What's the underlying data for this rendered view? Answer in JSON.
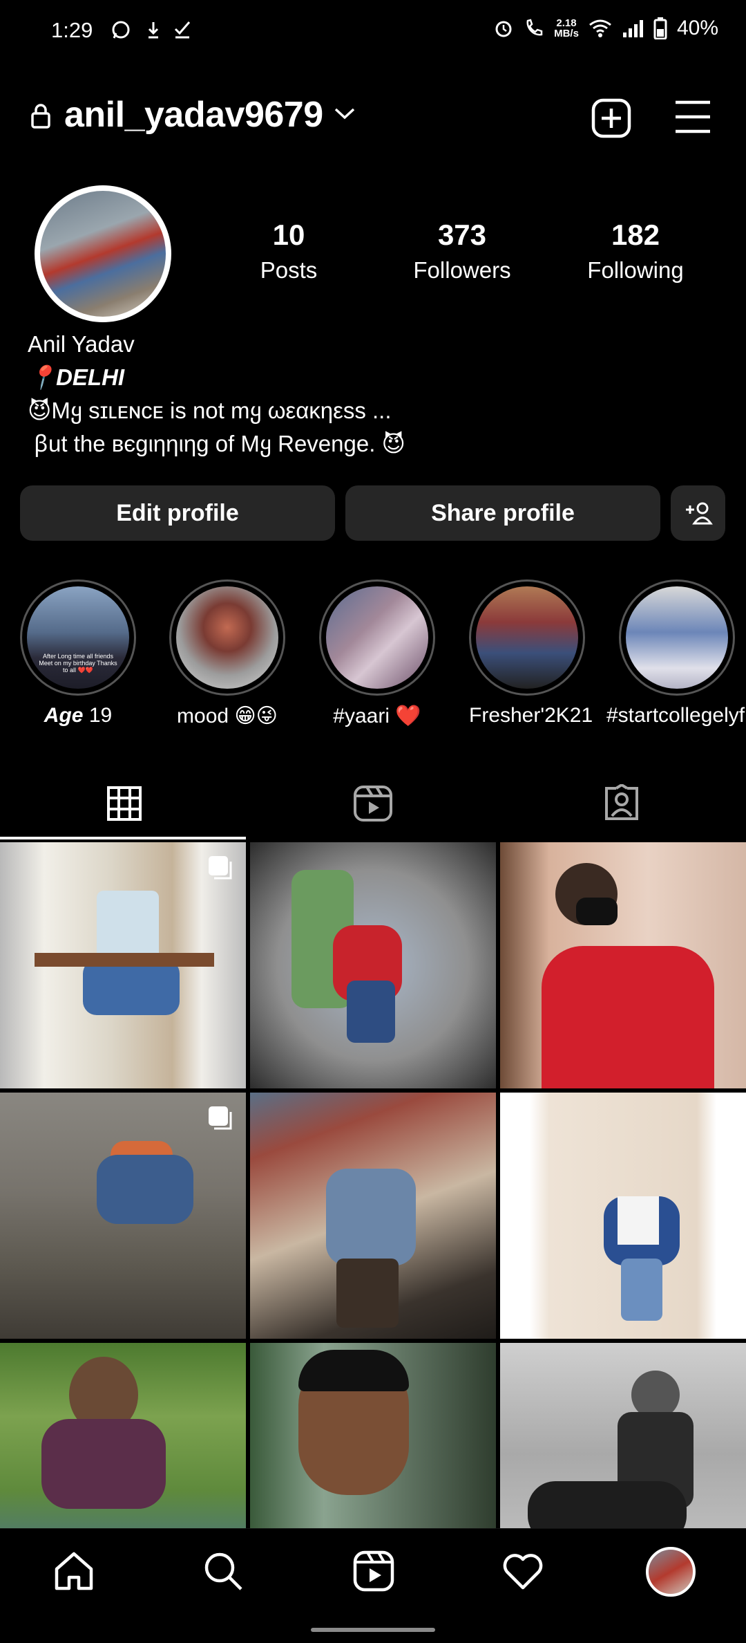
{
  "status_bar": {
    "time": "1:29",
    "speed_value": "2.18",
    "speed_unit": "MB/s",
    "battery": "40%"
  },
  "header": {
    "username": "anil_yadav9679"
  },
  "stats": [
    {
      "value": "10",
      "label": "Posts"
    },
    {
      "value": "373",
      "label": "Followers"
    },
    {
      "value": "182",
      "label": "Following"
    }
  ],
  "bio": {
    "name": "Anil Yadav",
    "location": "📍DELHI",
    "line1": "😈Mყ sɪʟᴇɴᴄᴇ is not mყ ωεακηεss ...",
    "line2": " ꞵut the вєɡιηηιηɡ of Mყ Revenge. 😈"
  },
  "buttons": {
    "edit_profile": "Edit profile",
    "share_profile": "Share profile"
  },
  "highlights": [
    {
      "caption_bold": "Age",
      "caption": " 19"
    },
    {
      "caption_bold": "",
      "caption": "mood 😁😜"
    },
    {
      "caption_bold": "",
      "caption": "#yaari ❤️"
    },
    {
      "caption_bold": "",
      "caption": "Fresher'2K21"
    },
    {
      "caption_bold": "",
      "caption": "#startcollegelyf"
    }
  ],
  "highlight_text": {
    "first": "After Long time all friends Meet on my birthday Thanks to all ❤️❤️"
  },
  "tabs": [
    "posts-grid",
    "reels",
    "tagged"
  ],
  "colors": {
    "background": "#000000",
    "button": "#262626",
    "text": "#ffffff"
  }
}
